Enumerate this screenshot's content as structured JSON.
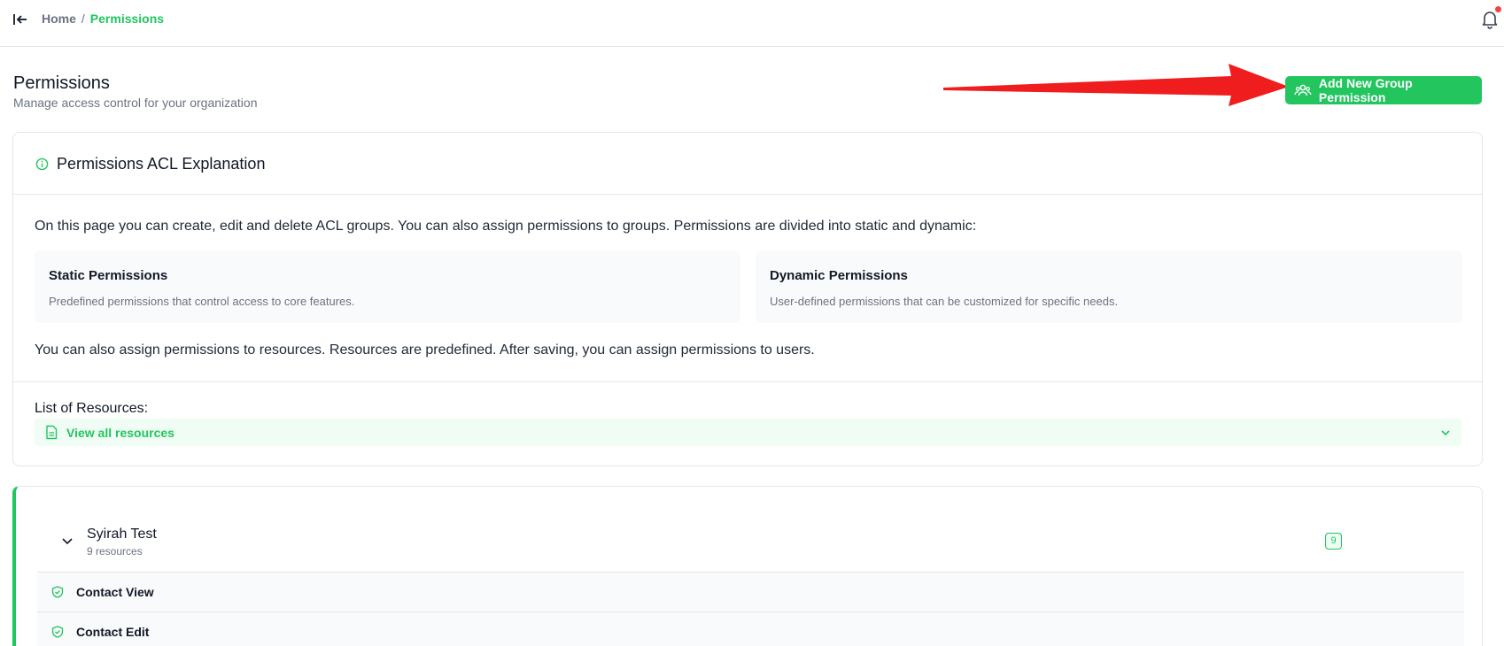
{
  "breadcrumb": {
    "home": "Home",
    "separator": "/",
    "current": "Permissions"
  },
  "header": {
    "title": "Permissions",
    "subtitle": "Manage access control for your organization",
    "add_button_label": "Add New Group Permission"
  },
  "explanation": {
    "title": "Permissions ACL Explanation",
    "intro": "On this page you can create, edit and delete ACL groups. You can also assign permissions to groups. Permissions are divided into static and dynamic:",
    "static": {
      "title": "Static Permissions",
      "description": "Predefined permissions that control access to core features."
    },
    "dynamic": {
      "title": "Dynamic Permissions",
      "description": "User-defined permissions that can be customized for specific needs."
    },
    "note": "You can also assign permissions to resources. Resources are predefined. After saving, you can assign permissions to users.",
    "resources_label": "List of Resources:",
    "resources_link": "View all resources"
  },
  "group": {
    "name": "Syirah Test",
    "count_text": "9 resources",
    "badge": "9",
    "resources": [
      {
        "label": "Contact View"
      },
      {
        "label": "Contact Edit"
      }
    ]
  },
  "colors": {
    "accent": "#22c55e",
    "annotation_arrow": "#ef1d1d",
    "notification_dot": "#ef4444"
  }
}
